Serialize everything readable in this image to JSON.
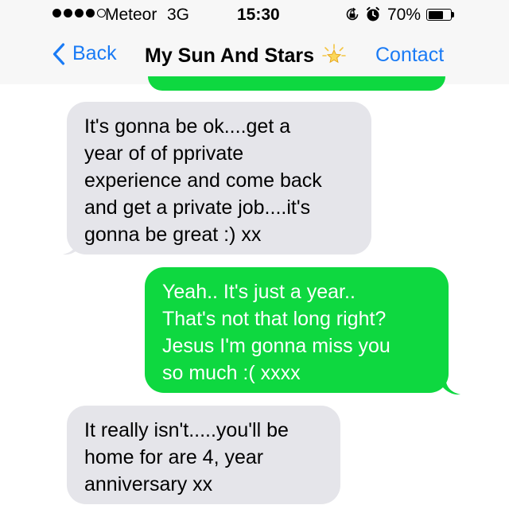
{
  "status_bar": {
    "carrier": "Meteor",
    "network": "3G",
    "time": "15:30",
    "battery_percent": "70%",
    "battery_level": 0.7,
    "signal_bars_filled": 4,
    "signal_bars_total": 5,
    "icons": [
      "rotation-lock-icon",
      "alarm-icon",
      "battery-icon"
    ]
  },
  "nav": {
    "back_label": "Back",
    "title": "My Sun And Stars",
    "title_icon": "star-icon",
    "contact_label": "Contact"
  },
  "messages": [
    {
      "direction": "received",
      "text": "It's gonna be ok....get a\nyear of of pprivate\nexperience and come back\nand get a private job....it's\ngonna be great :) xx"
    },
    {
      "direction": "sent",
      "text": "Yeah.. It's just a year..\nThat's not that long right?\nJesus I'm gonna miss you\nso much :( xxxx"
    },
    {
      "direction": "received",
      "text": "It really isn't.....you'll be\nhome for are 4, year\nanniversary xx"
    }
  ],
  "colors": {
    "sent_bubble": "#0ed840",
    "received_bubble": "#e5e5ea",
    "accent": "#1a7bf5",
    "bar_background": "#f7f7f7"
  }
}
